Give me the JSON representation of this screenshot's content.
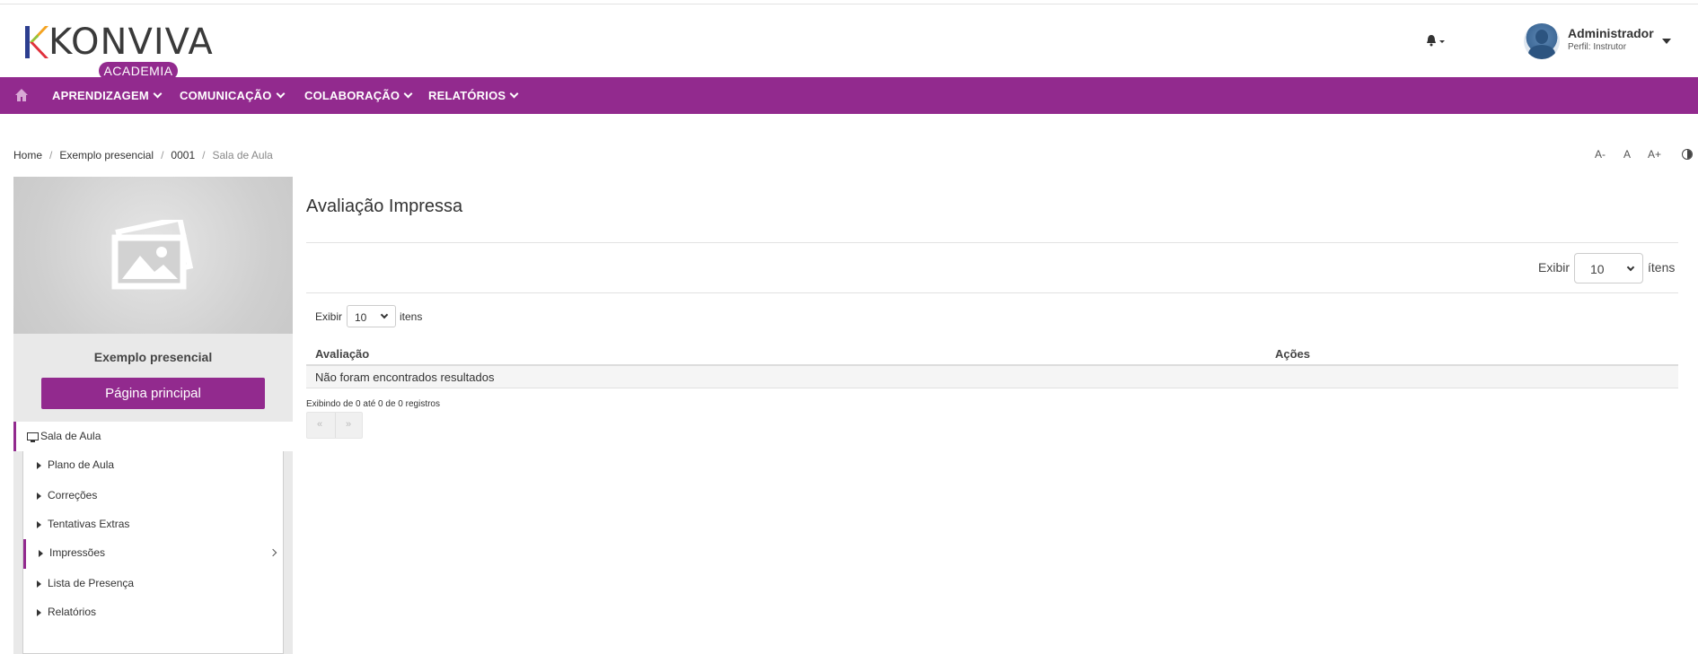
{
  "brand": {
    "name": "KONVIVA",
    "badge": "ACADEMIA",
    "color": "#922a8e"
  },
  "header": {
    "bell_icon": "bell-icon",
    "user": {
      "name": "Administrador",
      "role": "Perfil: Instrutor"
    }
  },
  "nav": {
    "home_icon": "home-icon",
    "items": [
      {
        "label": "APRENDIZAGEM"
      },
      {
        "label": "COMUNICAÇÃO"
      },
      {
        "label": "COLABORAÇÃO"
      },
      {
        "label": "RELATÓRIOS"
      }
    ]
  },
  "breadcrumb": {
    "items": [
      "Home",
      "Exemplo presencial",
      "0001",
      "Sala de Aula"
    ],
    "separator": "/"
  },
  "font_controls": {
    "decrease": "A-",
    "normal": "A",
    "increase": "A+",
    "contrast_icon": "contrast-icon"
  },
  "sidebar": {
    "course_title": "Exemplo presencial",
    "main_button": "Página principal",
    "active_section": "Sala de Aula",
    "submenu": [
      {
        "label": "Plano de Aula",
        "active": false
      },
      {
        "label": "Correções",
        "active": false
      },
      {
        "label": "Tentativas Extras",
        "active": false
      },
      {
        "label": "Impressões",
        "active": true
      },
      {
        "label": "Lista de Presença",
        "active": false
      },
      {
        "label": "Relatórios",
        "active": false
      }
    ]
  },
  "main": {
    "title": "Avaliação Impressa",
    "top_length": {
      "prefix": "Exibir",
      "value": "10",
      "suffix": "ítens"
    },
    "inner_length": {
      "prefix": "Exibir",
      "value": "10",
      "suffix": "itens"
    },
    "table": {
      "columns": [
        "Avaliação",
        "Ações"
      ],
      "empty_message": "Não foram encontrados resultados"
    },
    "info": "Exibindo de 0 até 0 de 0 registros",
    "pager": {
      "prev": "«",
      "next": "»"
    }
  }
}
